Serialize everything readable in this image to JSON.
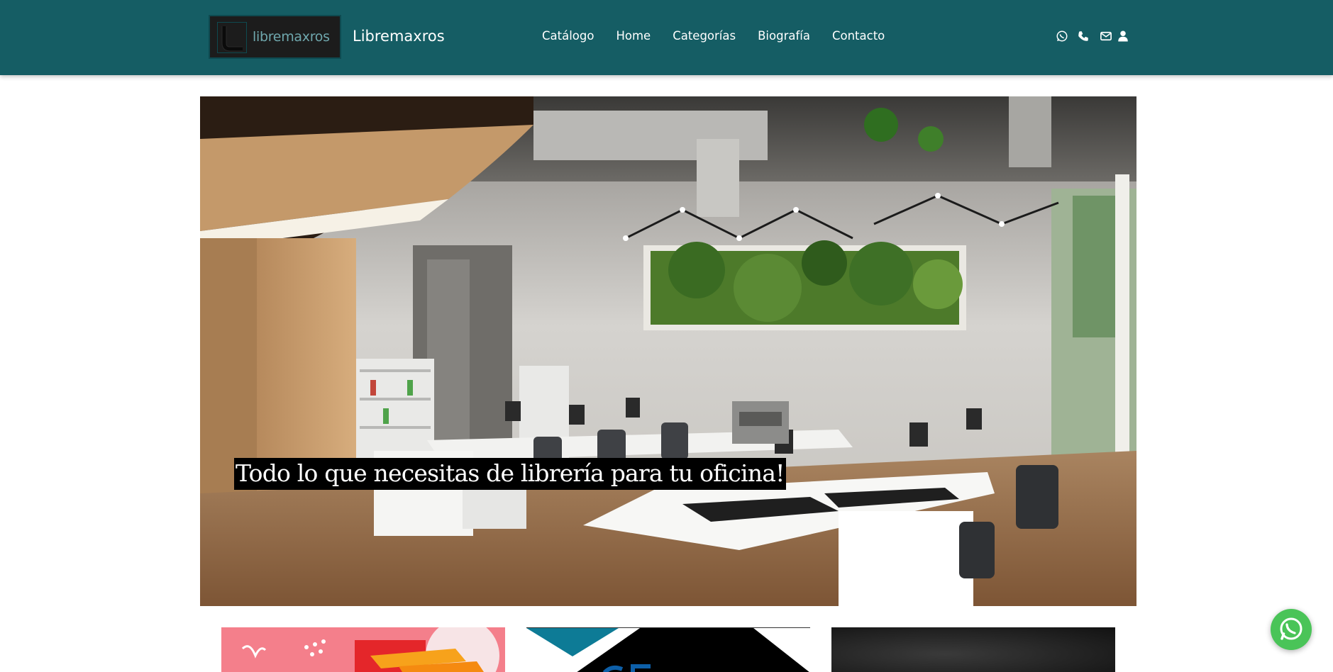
{
  "header": {
    "logo_text": "libremaxros",
    "brand_name": "Libremaxros",
    "nav": [
      {
        "label": "Catálogo"
      },
      {
        "label": "Home"
      },
      {
        "label": "Categorías"
      },
      {
        "label": "Biografía"
      },
      {
        "label": "Contacto"
      }
    ],
    "icons": [
      "whatsapp-icon",
      "phone-icon",
      "envelope-icon",
      "user-icon"
    ]
  },
  "hero": {
    "caption": "Todo lo que necesitas de librería para tu oficina!"
  },
  "colors": {
    "navbar": "#155d64",
    "whatsapp": "#4ac458",
    "card_pink": "#f47f8b"
  }
}
